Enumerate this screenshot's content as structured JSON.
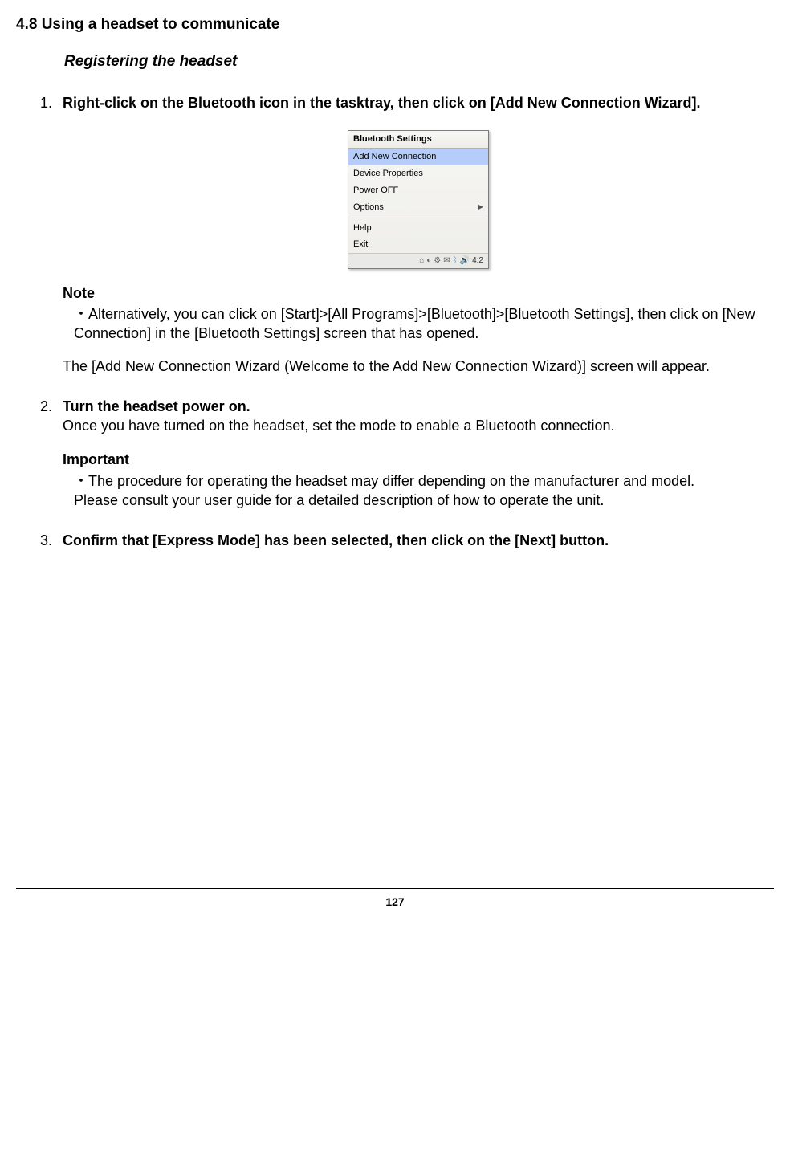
{
  "section": {
    "number_title": "4.8  Using a headset to communicate",
    "subtitle": "Registering the headset"
  },
  "steps": {
    "s1": {
      "bold": "Right-click on the Bluetooth icon in the tasktray, then click on [Add New Connection Wizard].",
      "note_label": "Note",
      "note_text": "・Alternatively, you can click on [Start]>[All Programs]>[Bluetooth]>[Bluetooth Settings], then click on [New Connection] in the [Bluetooth Settings] screen that has opened.",
      "after_note": "The [Add New Connection Wizard (Welcome to the Add New Connection Wizard)] screen will appear."
    },
    "s2": {
      "bold": "Turn the headset power on.",
      "desc": "Once you have turned on the headset, set the mode to enable a Bluetooth connection.",
      "important_label": "Important",
      "important_text": "・The procedure for operating the headset may differ depending on the manufacturer and model.",
      "important_tail": "Please consult your user guide for a detailed description of how to operate the unit."
    },
    "s3": {
      "bold": "Confirm that [Express Mode] has been selected, then click on the [Next] button."
    }
  },
  "menu": {
    "title": "Bluetooth Settings",
    "items": {
      "i0": "Add New Connection",
      "i1": "Device Properties",
      "i2": "Power OFF",
      "i3": "Options",
      "i3_arrow": "▶",
      "i4": "Help",
      "i5": "Exit"
    },
    "tray_time": "4:2"
  },
  "page_number": "127"
}
